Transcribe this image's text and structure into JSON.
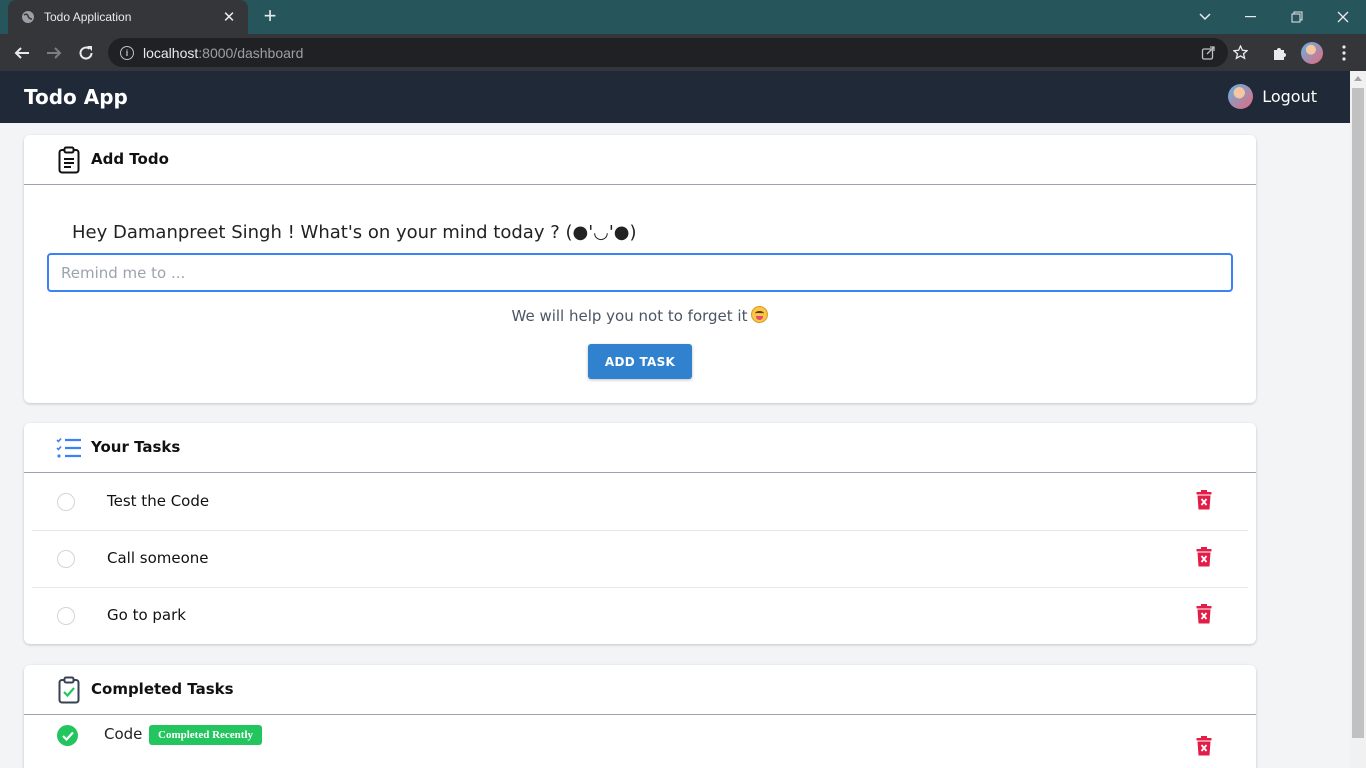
{
  "browser": {
    "tab_title": "Todo Application",
    "tab_close": "✕",
    "new_tab": "+",
    "url_host": "localhost",
    "url_path": ":8000/dashboard"
  },
  "navbar": {
    "brand": "Todo App",
    "logout_label": "Logout"
  },
  "add_todo": {
    "title": "Add Todo",
    "greeting": "Hey Damanpreet Singh ! What's on your mind today ? (●'◡'●)",
    "input_placeholder": "Remind me to ...",
    "input_value": "",
    "helper_text": "We will help you not to forget it",
    "button_label": "ADD TASK"
  },
  "your_tasks": {
    "title": "Your Tasks",
    "items": [
      {
        "text": "Test the Code"
      },
      {
        "text": "Call someone"
      },
      {
        "text": "Go to park"
      }
    ]
  },
  "completed_tasks": {
    "title": "Completed Tasks",
    "items": [
      {
        "text": "Code",
        "badge": "Completed Recently"
      }
    ]
  },
  "colors": {
    "navbar": "#1f2937",
    "accent": "#3182ce",
    "danger": "#e11d48",
    "success": "#22c55e"
  }
}
